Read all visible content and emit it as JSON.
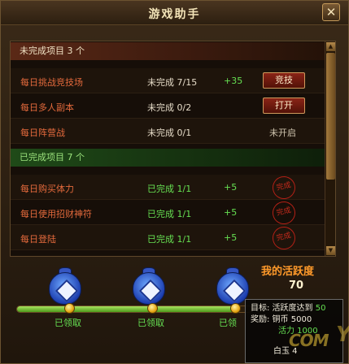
{
  "window": {
    "title": "游戏助手",
    "close_label": "✕"
  },
  "sections": {
    "incomplete_title": "未完成项目 3 个",
    "complete_title": "已完成项目 7 个"
  },
  "incomplete_items": [
    {
      "name": "每日挑战竞技场",
      "status": "未完成 7/15",
      "reward": "+35",
      "action": "竞技"
    },
    {
      "name": "每日多人副本",
      "status": "未完成 0/2",
      "reward": "",
      "action": "打开"
    },
    {
      "name": "每日阵营战",
      "status": "未完成 0/1",
      "reward": "",
      "action": "未开启"
    }
  ],
  "complete_items": [
    {
      "name": "每日购买体力",
      "status": "已完成 1/1",
      "reward": "+5",
      "stamp": "完成"
    },
    {
      "name": "每日使用招财神符",
      "status": "已完成 1/1",
      "reward": "+5",
      "stamp": "完成"
    },
    {
      "name": "每日登陆",
      "status": "已完成 1/1",
      "reward": "+5",
      "stamp": "完成"
    }
  ],
  "activity": {
    "label": "我的活跃度",
    "value": "70"
  },
  "rewards": {
    "progress_fraction": 0.93,
    "milestones": [
      {
        "label": "已领取"
      },
      {
        "label": "已领取"
      },
      {
        "label": "已领"
      }
    ]
  },
  "tooltip": {
    "line1_prefix": "目标: 活跃度达到",
    "line1_value": "50",
    "line2": "奖励: 铜币 5000",
    "line3": "活力 1000",
    "line4": "白玉 4"
  },
  "watermark": {
    "text": "COM",
    "letter": "Y"
  },
  "colors": {
    "accent_red": "#e46a3c",
    "done_green": "#66e052",
    "activity_orange": "#ff9a2a"
  }
}
